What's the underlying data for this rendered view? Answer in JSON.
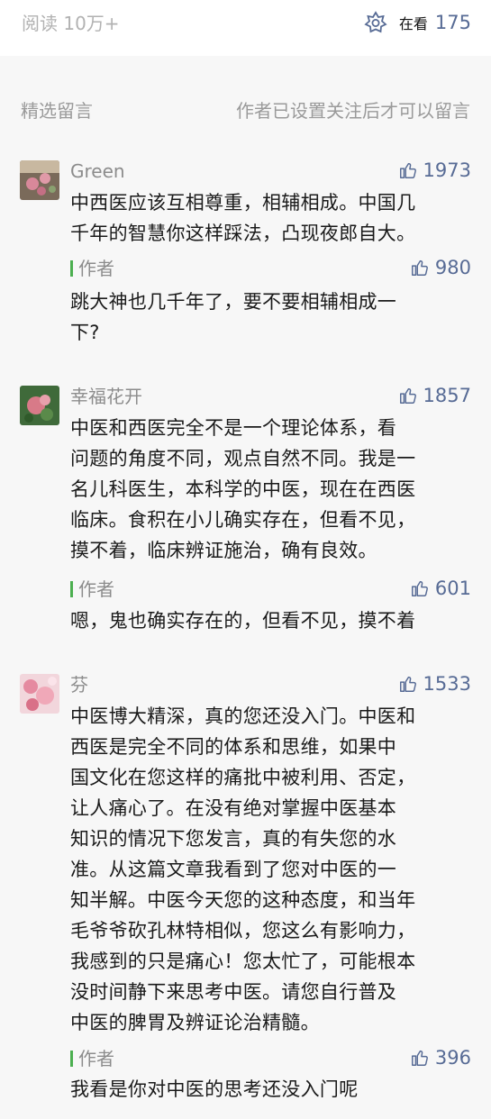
{
  "stats": {
    "read_count": "阅读 10万+",
    "watching_label": "在看",
    "watching_count": "175"
  },
  "comments_section": {
    "title": "精选留言",
    "note": "作者已设置关注后才可以留言"
  },
  "comments": [
    {
      "nickname": "Green",
      "likes": "1973",
      "lines": [
        "中西医应该互相尊重，相辅相成。中国几",
        "千年的智慧你这样踩法，凸现夜郎自大。"
      ],
      "reply": {
        "label": "作者",
        "likes": "980",
        "lines": [
          "跳大神也几千年了，要不要相辅相成一",
          "下?"
        ]
      }
    },
    {
      "nickname": "幸福花开",
      "likes": "1857",
      "lines": [
        "中医和西医完全不是一个理论体系，看",
        "问题的角度不同，观点自然不同。我是一",
        "名儿科医生，本科学的中医，现在在西医",
        "临床。食积在小儿确实存在，但看不见，",
        "摸不着，临床辨证施治，确有良效。"
      ],
      "reply": {
        "label": "作者",
        "likes": "601",
        "lines": [
          "嗯，鬼也确实存在的，但看不见，摸不着"
        ]
      }
    },
    {
      "nickname": "芬",
      "likes": "1533",
      "lines": [
        "中医博大精深，真的您还没入门。中医和",
        "西医是完全不同的体系和思维，如果中",
        "国文化在您这样的痛批中被利用、否定，",
        "让人痛心了。在没有绝对掌握中医基本",
        "知识的情况下您发言，真的有失您的水",
        "准。从这篇文章我看到了您对中医的一",
        "知半解。中医今天您的这种态度，和当年",
        "毛爷爷砍孔林特相似，您这么有影响力，",
        "我感到的只是痛心！您太忙了，可能根本",
        "没时间静下来思考中医。请您自行普及",
        "中医的脾胃及辨证论治精髓。"
      ],
      "reply": {
        "label": "作者",
        "likes": "396",
        "lines": [
          "我看是你对中医的思考还没入门呢"
        ]
      }
    }
  ],
  "colors": {
    "link_blue": "#576b95",
    "author_green": "#4caf50",
    "muted_gray": "#9a9a9a"
  },
  "icons": {
    "watching": "flower-icon",
    "like": "thumbs-up-icon"
  }
}
